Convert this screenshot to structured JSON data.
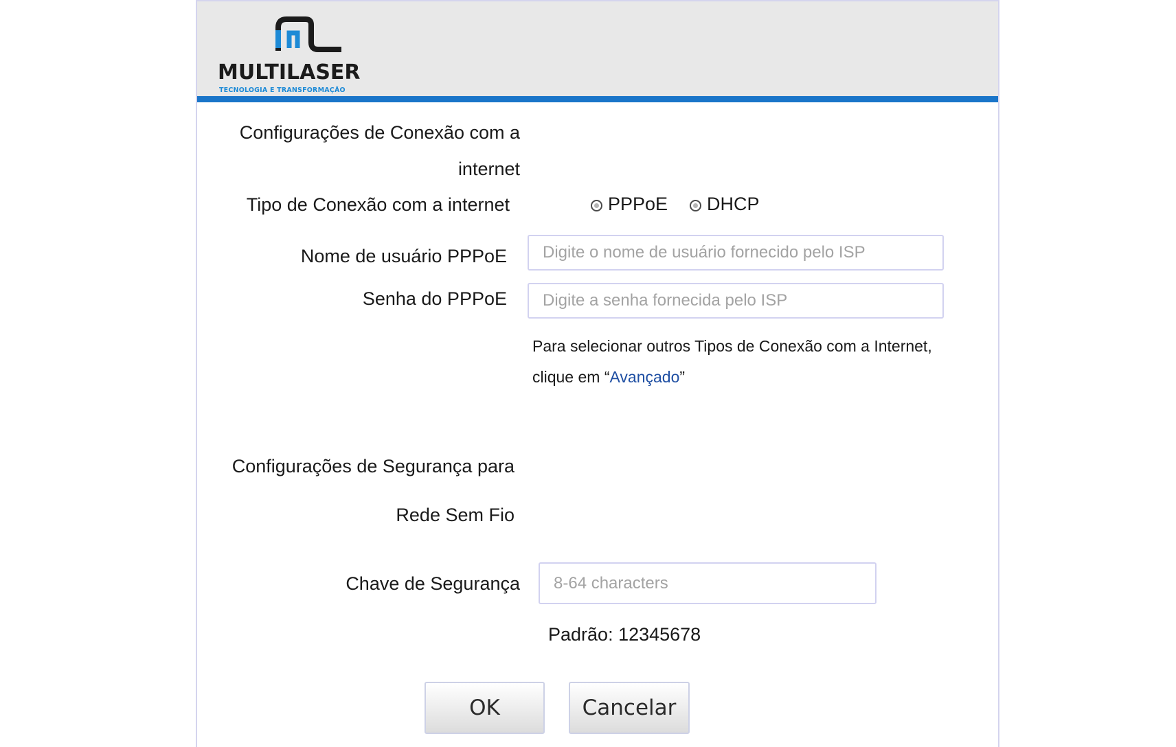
{
  "brand": {
    "name": "MULTILASER",
    "tagline": "TECNOLOGIA E TRANSFORMAÇÃO",
    "accent_color": "#1a75c9",
    "tagline_color": "#1d8ad6"
  },
  "internet_section": {
    "title_line1": "Configurações de Conexão com a",
    "title_line2": "internet",
    "connection_type_label": "Tipo de Conexão com a internet",
    "options": [
      {
        "label": "PPPoE"
      },
      {
        "label": "DHCP"
      }
    ],
    "username_label": "Nome de usuário PPPoE",
    "username_placeholder": "Digite o nome de usuário fornecido pelo ISP",
    "password_label": "Senha do PPPoE",
    "password_placeholder": "Digite a senha fornecida pelo ISP",
    "note_line1": "Para selecionar outros Tipos de Conexão com a Internet,",
    "note_prefix": "clique em “",
    "note_link": "Avançado",
    "note_suffix": "”"
  },
  "wireless_section": {
    "title_line1": "Configurações de Segurança para",
    "title_line2": "Rede Sem Fio",
    "key_label": "Chave de Segurança",
    "key_placeholder": "8-64 characters",
    "default_text": "Padrão: 12345678"
  },
  "buttons": {
    "ok": "OK",
    "cancel": "Cancelar"
  }
}
